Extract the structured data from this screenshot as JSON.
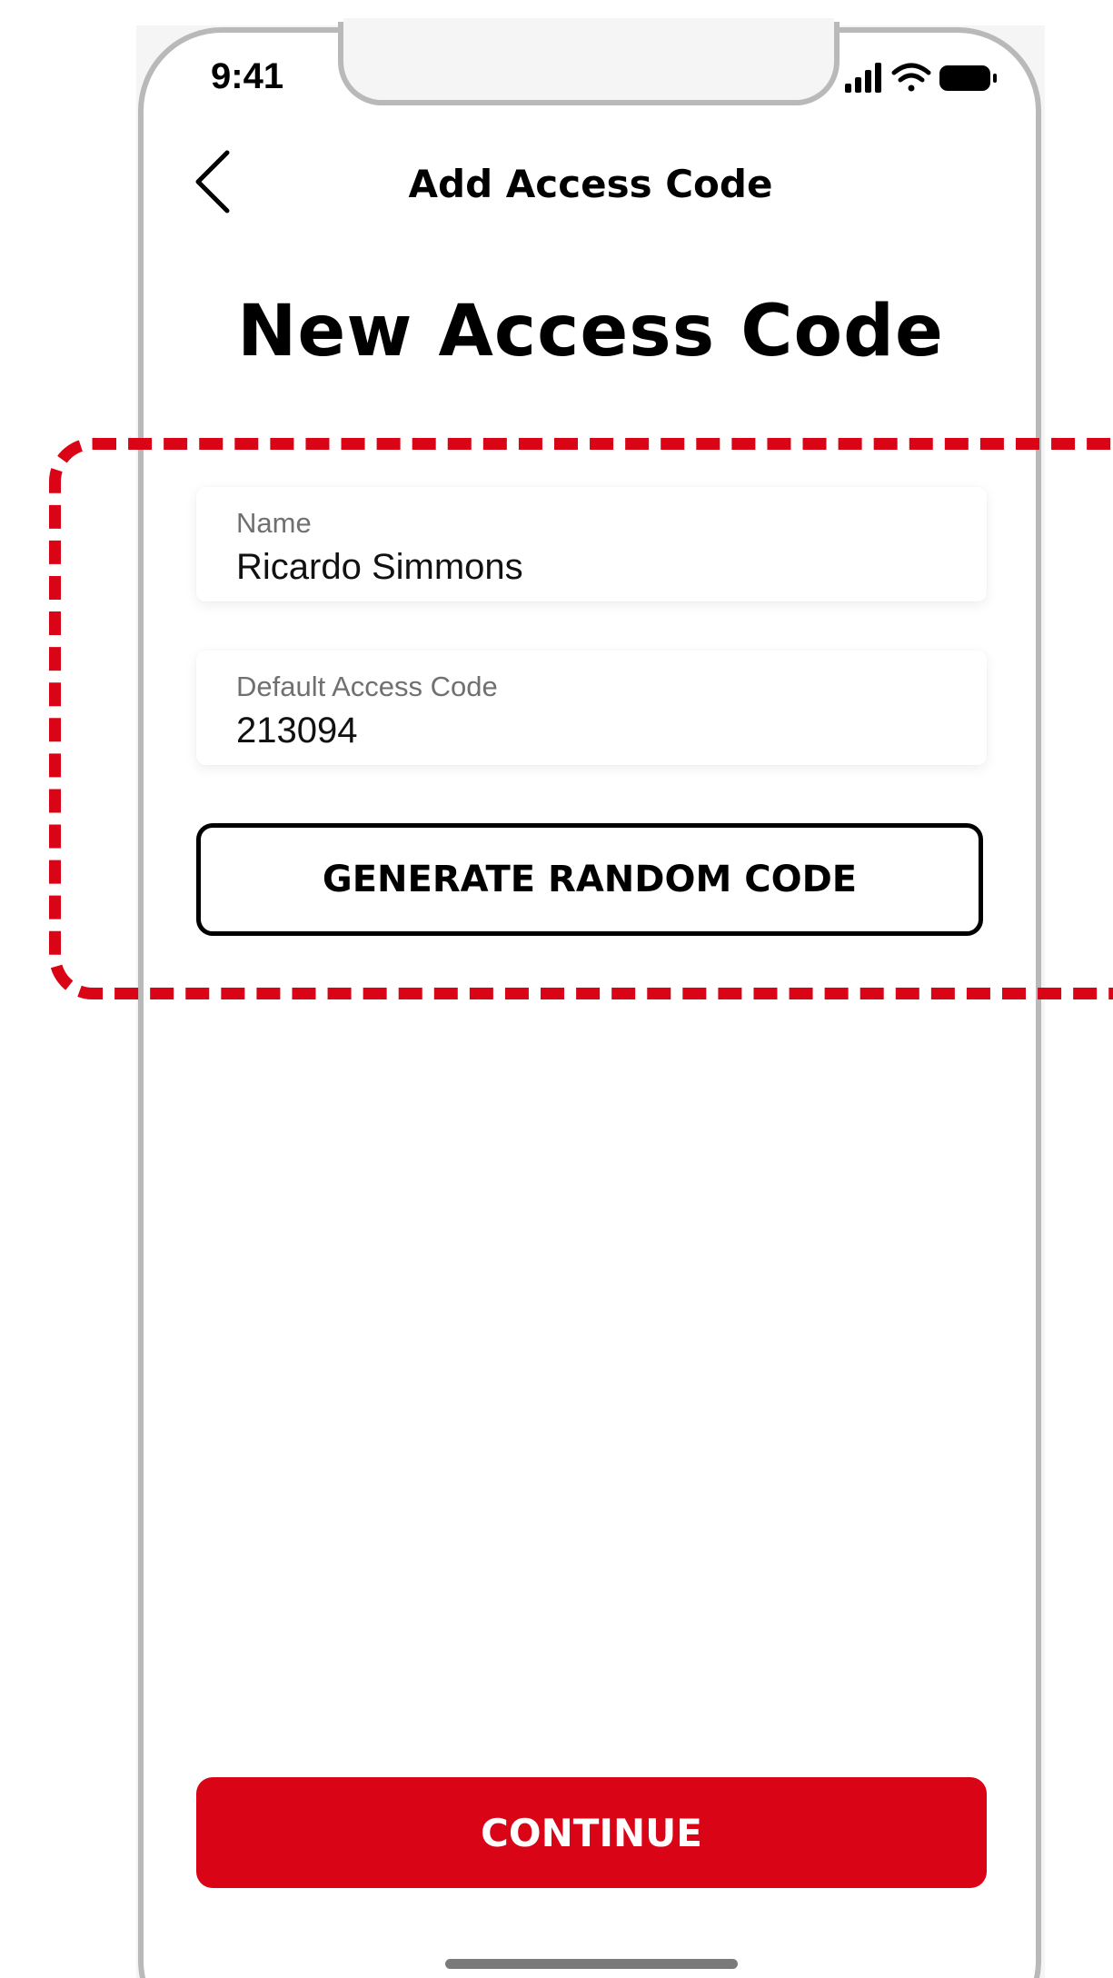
{
  "status_bar": {
    "time": "9:41",
    "icons": [
      "cellular-signal-icon",
      "wifi-icon",
      "battery-icon"
    ]
  },
  "nav": {
    "back_icon": "chevron-left-icon",
    "title": "Add Access Code"
  },
  "page": {
    "title": "New Access Code"
  },
  "form": {
    "name": {
      "label": "Name",
      "value": "Ricardo Simmons"
    },
    "access_code": {
      "label": "Default Access Code",
      "value": "213094"
    },
    "generate_button_label": "GENERATE RANDOM CODE"
  },
  "footer": {
    "continue_label": "CONTINUE"
  },
  "colors": {
    "accent": "#d90416",
    "frame": "#b9b9b9",
    "text": "#000000",
    "label": "#707070"
  }
}
